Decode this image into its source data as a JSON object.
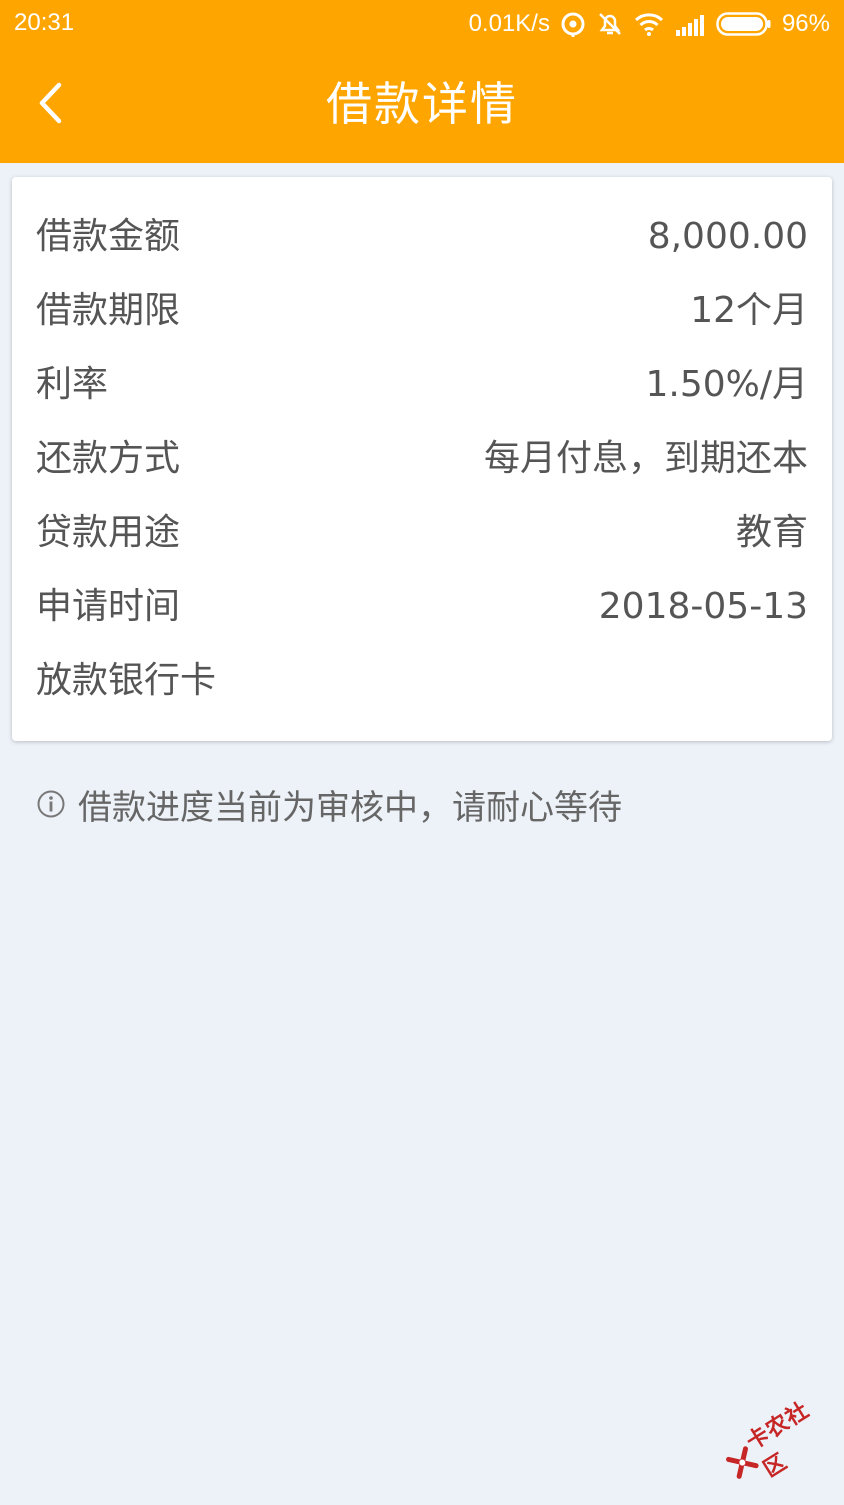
{
  "status_bar": {
    "time": "20:31",
    "net_speed": "0.01K/s",
    "battery": "96%",
    "icons": [
      "data-saver-icon",
      "alarm-off-icon",
      "wifi-icon",
      "signal-icon",
      "battery-icon"
    ]
  },
  "header": {
    "back_icon": "chevron-left-icon",
    "title": "借款详情",
    "color": "#ffa500"
  },
  "details": [
    {
      "label": "借款金额",
      "value": "8,000.00"
    },
    {
      "label": "借款期限",
      "value": "12个月"
    },
    {
      "label": "利率",
      "value": "1.50%/月"
    },
    {
      "label": "还款方式",
      "value": "每月付息，到期还本"
    },
    {
      "label": "贷款用途",
      "value": "教育"
    },
    {
      "label": "申请时间",
      "value": "2018-05-13"
    },
    {
      "label": "放款银行卡",
      "value": ""
    }
  ],
  "notice": {
    "icon": "info-icon",
    "text": "借款进度当前为审核中，请耐心等待"
  },
  "watermark": {
    "text": "卡农社区",
    "color": "#c72626"
  },
  "colors": {
    "background": "#edf2f8",
    "card": "#ffffff",
    "text": "#555555"
  }
}
